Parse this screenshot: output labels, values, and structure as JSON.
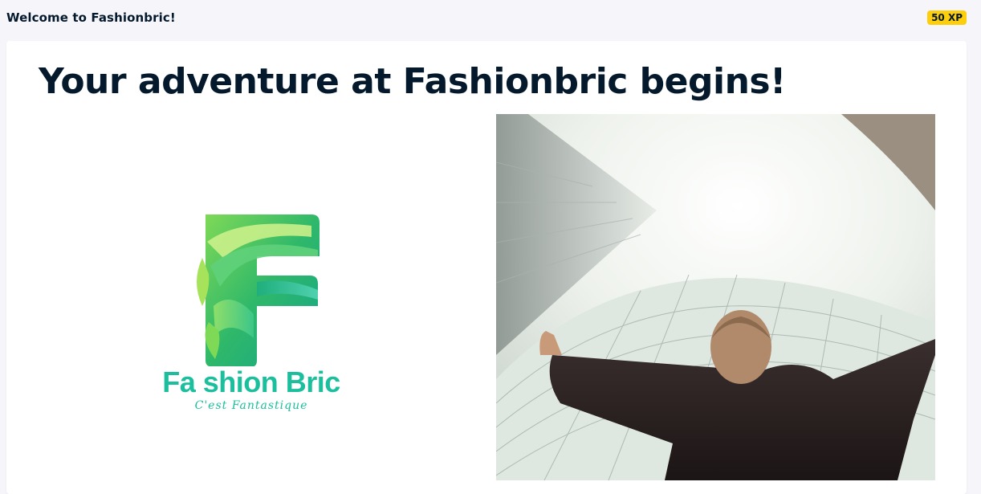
{
  "header": {
    "title": "Welcome to Fashionbric!",
    "xp_badge": "50 XP"
  },
  "main": {
    "headline": "Your adventure at Fashionbric begins!",
    "logo": {
      "name": "Fa shion Bric",
      "tagline": "C'est Fantastique",
      "icon": "letter-f-leaf-logo"
    },
    "photo": {
      "icon": "man-arms-raised-skyscraper-photo"
    }
  },
  "colors": {
    "badge": "#fcce0d",
    "brand_teal": "#1bbf9d",
    "text_dark": "#05192d"
  }
}
